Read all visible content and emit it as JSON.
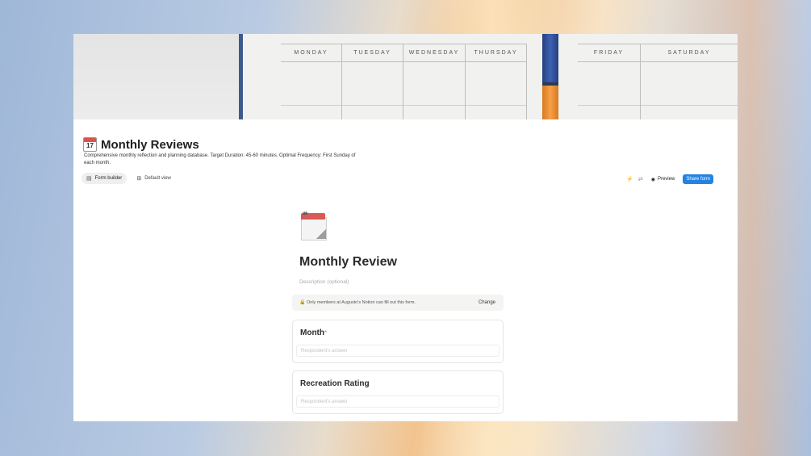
{
  "cover": {
    "days": [
      "MONDAY",
      "TUESDAY",
      "WEDNESDAY",
      "THURSDAY",
      "FRIDAY",
      "SATURDAY"
    ]
  },
  "page": {
    "icon_number": "17",
    "title": "Monthly Reviews",
    "description": "Comprehensive monthly reflection and planning database. Target Duration: 45-60 minutes. Optimal Frequency: First Sunday of each month."
  },
  "tabs": [
    {
      "label": "Form builder",
      "icon": "form-icon"
    },
    {
      "label": "Default view",
      "icon": "table-icon"
    }
  ],
  "toolbar": {
    "preview_label": "Preview",
    "share_label": "Share form"
  },
  "form": {
    "title": "Monthly Review",
    "description_placeholder": "Description (optional)",
    "notice_text": "Only members at Augusto's Notion can fill out this form.",
    "change_label": "Change",
    "questions": [
      {
        "label": "Month",
        "required": "*",
        "placeholder": "Respondent's answer"
      },
      {
        "label": "Recreation Rating",
        "required": "",
        "placeholder": "Respondent's answer"
      }
    ]
  },
  "colors": {
    "accent": "#2383e2",
    "required": "#e0706b"
  }
}
